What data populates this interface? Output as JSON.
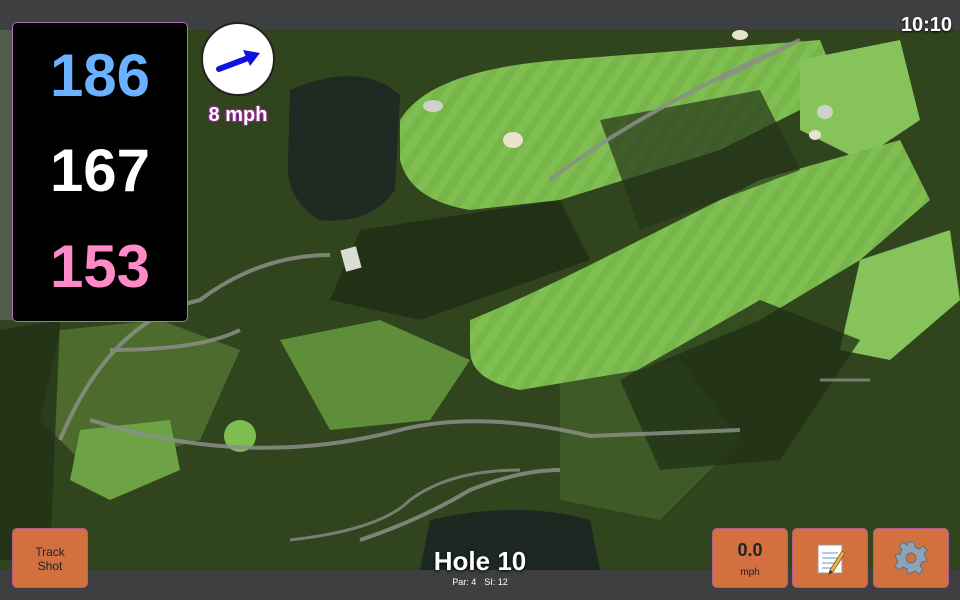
{
  "clock": "10:10",
  "distances": {
    "back": "186",
    "center": "167",
    "front": "153"
  },
  "wind": {
    "speed_label": "8 mph",
    "arrow_icon": "wind-direction-arrow-icon",
    "arrow_color": "#1111dd"
  },
  "buttons": {
    "track_shot": "Track\nShot",
    "speed_value": "0.0",
    "speed_unit": "mph",
    "notes_icon": "notepad-icon",
    "settings_icon": "gear-icon"
  },
  "hole": {
    "title": "Hole 10",
    "par": "Par: 4",
    "si": "SI: 12"
  },
  "colors": {
    "button": "#d2703f",
    "back_distance": "#6ab2ff",
    "front_distance": "#ff8ac7",
    "panel_border": "#b76ab5"
  }
}
